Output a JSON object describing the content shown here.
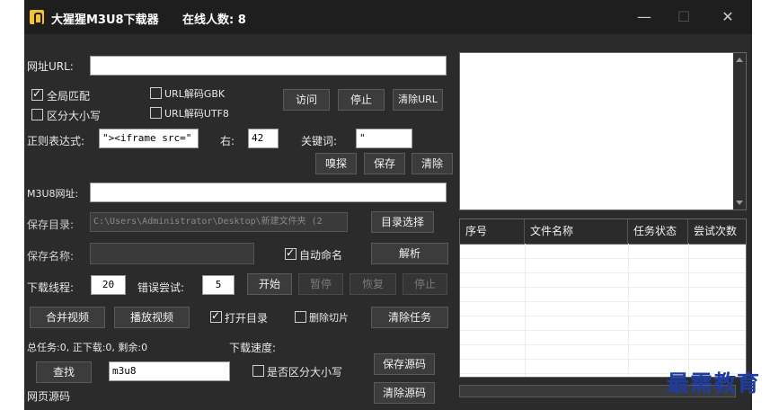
{
  "window": {
    "title": "大猩猩M3U8下载器",
    "online_users": "在线人数: 8",
    "minimize_glyph": "—",
    "maximize_glyph": "☐",
    "close_glyph": "✕"
  },
  "url_section": {
    "url_label": "网址URL:",
    "url_value": "",
    "global_match": {
      "label": "全局匹配",
      "checked": true
    },
    "case_sensitive": {
      "label": "区分大小写",
      "checked": false
    },
    "decode_gbk": {
      "label": "URL解码GBK",
      "checked": false
    },
    "decode_utf8": {
      "label": "URL解码UTF8",
      "checked": false
    },
    "visit_button": "访问",
    "stop_button": "停止",
    "clear_url_button": "清除URL"
  },
  "regex_section": {
    "regex_label": "正则表达式:",
    "regex_value": "\"><iframe src=\"",
    "right_label": "右:",
    "right_value": "42",
    "keyword_label": "关键词:",
    "keyword_value": "\"",
    "sniff_button": "嗅探",
    "save_button": "保存",
    "clear_button": "清除"
  },
  "m3u8_section": {
    "m3u8_label": "M3U8网址:",
    "m3u8_value": "",
    "save_dir_label": "保存目录:",
    "save_dir_value": "C:\\Users\\Administrator\\Desktop\\新建文件夹 (2",
    "dir_select_button": "目录选择",
    "save_name_label": "保存名称:",
    "save_name_value": "",
    "auto_name": {
      "label": "自动命名",
      "checked": true
    },
    "parse_button": "解析"
  },
  "download_section": {
    "threads_label": "下载线程:",
    "threads_value": "20",
    "retry_label": "错误尝试:",
    "retry_value": "5",
    "start_button": "开始",
    "pause_button": "暂停",
    "resume_button": "恢复",
    "stop_button": "停止"
  },
  "actions": {
    "merge_button": "合并视频",
    "play_button": "播放视频",
    "open_dir": {
      "label": "打开目录",
      "checked": true
    },
    "delete_slices": {
      "label": "删除切片",
      "checked": false
    },
    "clear_tasks_button": "清除任务"
  },
  "status": {
    "summary": "总任务:0, 正下载:0, 剩余:0",
    "speed_label": "下载速度:"
  },
  "find_section": {
    "find_button": "查找",
    "find_value": "m3u8",
    "case_sensitive": {
      "label": "是否区分大小写",
      "checked": false
    },
    "save_source_button": "保存源码",
    "clear_source_button": "清除源码",
    "source_label": "网页源码"
  },
  "task_table": {
    "columns": [
      "序号",
      "文件名称",
      "任务状态",
      "尝试次数"
    ]
  },
  "watermark": "最需教育",
  "colors": {
    "window_bg": "#2b2b2b",
    "titlebar_bg": "#1e1e1e",
    "watermark": "#1f3da0"
  }
}
